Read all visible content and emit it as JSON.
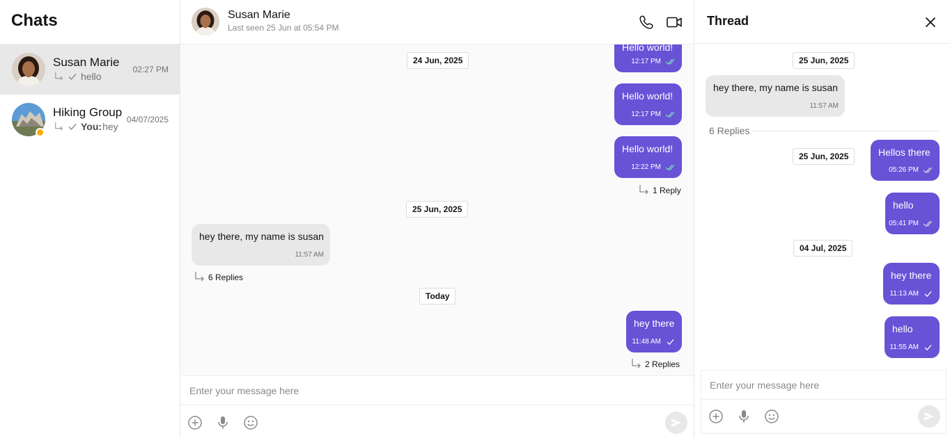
{
  "sidebar": {
    "title": "Chats",
    "chats": [
      {
        "name": "Susan Marie",
        "preview": "hello",
        "you_prefix": "",
        "time": "02:27 PM",
        "active": true
      },
      {
        "name": "Hiking Group",
        "preview": "hey",
        "you_prefix": "You:",
        "time": "04/07/2025",
        "active": false
      }
    ]
  },
  "header": {
    "name": "Susan Marie",
    "status": "Last seen 25 Jun at 05:54 PM",
    "call_icon": "phone-icon",
    "video_icon": "video-camera-icon"
  },
  "messages": {
    "partial_top": {
      "text": "Hello world!",
      "time": "12:17 PM",
      "receipt": "double-check"
    },
    "date1": "24 Jun, 2025",
    "m1": {
      "text": "Hello world!",
      "time": "12:17 PM",
      "receipt": "double-check"
    },
    "m2": {
      "text": "Hello world!",
      "time": "12:22 PM",
      "receipt": "double-check",
      "replies": "1 Reply"
    },
    "date2": "25 Jun, 2025",
    "m3": {
      "text": "hey there, my name is susan",
      "time": "11:57 AM",
      "replies": "6 Replies"
    },
    "date3": "Today",
    "m4": {
      "text": "hey there",
      "time": "11:48 AM",
      "receipt": "single-check",
      "replies": "2 Replies"
    }
  },
  "composer": {
    "placeholder": "Enter your message here",
    "tools": [
      "add-attachment-icon",
      "microphone-icon",
      "emoji-icon"
    ],
    "send_icon": "send-icon"
  },
  "thread": {
    "title": "Thread",
    "close_icon": "close-icon",
    "parent": {
      "date": "25 Jun, 2025",
      "text": "hey there, my name is susan",
      "time": "11:57 AM"
    },
    "replies_label": "6 Replies",
    "items": [
      {
        "date": "25 Jun, 2025",
        "text": "Hellos there",
        "time": "05:26 PM",
        "receipt": "double-check-gray"
      },
      {
        "text": "hello",
        "time": "05:41 PM",
        "receipt": "double-check-gray"
      },
      {
        "date": "04 Jul, 2025",
        "text": "hey there",
        "time": "11:13 AM",
        "receipt": "single-check"
      },
      {
        "text": "hello",
        "time": "11:55 AM",
        "receipt": "single-check"
      }
    ],
    "placeholder": "Enter your message here"
  },
  "colors": {
    "outgoing_bubble": "#6852D6",
    "incoming_bubble": "#E8E8E8",
    "read_receipt": "#7CE0B8",
    "status_dot": "#FFAB00"
  }
}
